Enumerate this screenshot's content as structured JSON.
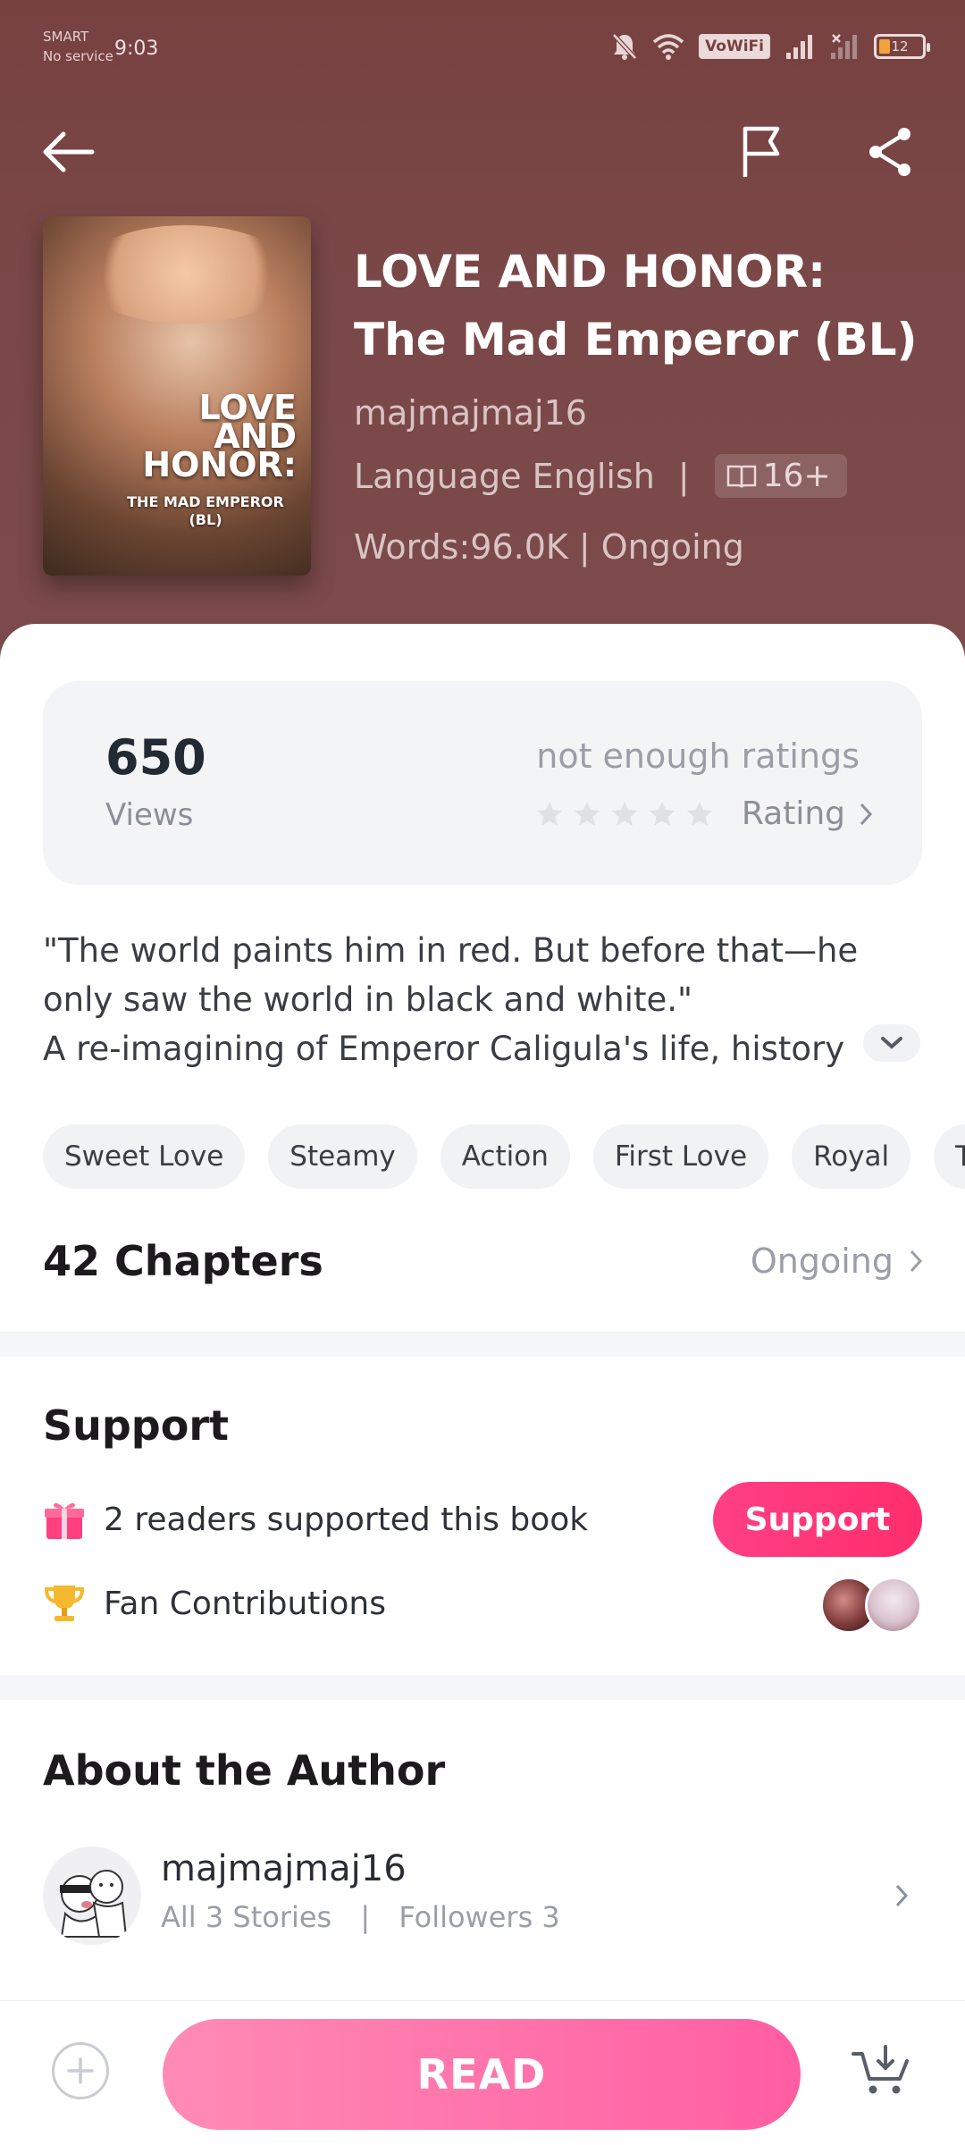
{
  "statusbar": {
    "carrier_line1": "SMART",
    "carrier_line2": "No service",
    "time": "9:03",
    "vowifi": "VoWiFi",
    "battery": "12"
  },
  "header": {
    "book_title": "LOVE AND HONOR: The Mad Emperor (BL)",
    "author": "majmajmaj16",
    "language_label": "Language English",
    "language_separator": "|",
    "age_rating": "16+",
    "words_status": "Words:96.0K | Ongoing"
  },
  "cover": {
    "title": "LOVE AND HONOR:",
    "subtitle": "THE MAD EMPEROR (BL)"
  },
  "stats": {
    "views_value": "650",
    "views_label": "Views",
    "rating_note": "not enough ratings",
    "rating_label": "Rating",
    "stars_filled": 0,
    "stars_total": 5
  },
  "synopsis": {
    "line1": "\"The world paints him in red. But before that—he",
    "line2": "only saw the world in black and white.\"",
    "line3": "A re-imagining of Emperor Caligula's life, history"
  },
  "tags": [
    "Sweet Love",
    "Steamy",
    "Action",
    "First Love",
    "Royal",
    "Twis"
  ],
  "chapters": {
    "title": "42 Chapters",
    "status": "Ongoing"
  },
  "support": {
    "title": "Support",
    "readers_text": "2 readers supported this book",
    "button_label": "Support",
    "fan_text": "Fan Contributions"
  },
  "about": {
    "title": "About the Author",
    "author_name": "majmajmaj16",
    "stories": "All 3 Stories",
    "separator": "|",
    "followers": "Followers 3"
  },
  "bottombar": {
    "read_label": "READ"
  },
  "colors": {
    "header_bg": "#7a4848",
    "accent_pink": "#ff2e6c",
    "read_gradient_start": "#ff8bb5",
    "read_gradient_end": "#ff5ea2"
  },
  "icons": [
    "back-arrow-icon",
    "flag-icon",
    "share-icon",
    "book-icon",
    "star-icon",
    "chevron-right-icon",
    "chevron-down-icon",
    "gift-icon",
    "trophy-icon",
    "add-icon",
    "cart-icon",
    "bell-off-icon",
    "wifi-icon",
    "signal-icon",
    "battery-icon"
  ]
}
